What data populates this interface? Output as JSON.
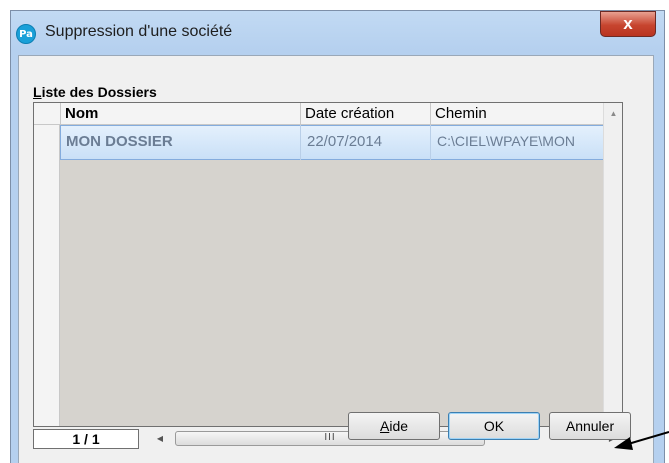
{
  "window": {
    "title": "Suppression d'une société",
    "app_icon_text": "Pa",
    "close_label": "x"
  },
  "group": {
    "label_accel": "L",
    "label_rest": "iste des Dossiers"
  },
  "grid": {
    "columns": [
      "Nom",
      "Date création",
      "Chemin"
    ],
    "rows": [
      {
        "nom": "MON DOSSIER",
        "date": "22/07/2014",
        "chemin": "C:\\CIEL\\WPAYE\\MON"
      }
    ]
  },
  "pager": {
    "text": "1 / 1"
  },
  "scroll": {
    "thumb_grip": "III"
  },
  "buttons": {
    "help_accel": "A",
    "help_rest": "ide",
    "ok": "OK",
    "cancel": "Annuler"
  }
}
